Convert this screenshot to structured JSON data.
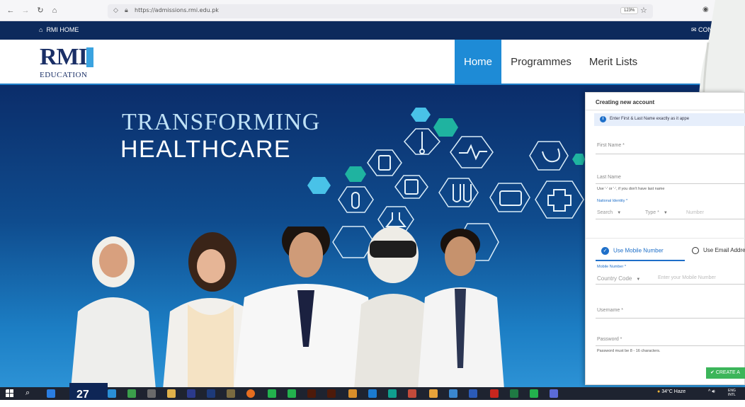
{
  "browser": {
    "url": "https://admissions.rmi.edu.pk",
    "zoom": "123%"
  },
  "topbar": {
    "home_label": "RMI HOME",
    "contact_label": "CONT"
  },
  "logo": {
    "brand": "RMI",
    "subtitle": "EDUCATION"
  },
  "nav": {
    "items": [
      "Home",
      "Programmes",
      "Merit Lists"
    ],
    "active": "Home"
  },
  "hero": {
    "title_line1": "TRANSFORMING",
    "title_line2": "HEALTHCARE"
  },
  "form": {
    "title": "Creating new account",
    "info": "Enter First & Last Name exactly as it appe",
    "first_name_label": "First Name *",
    "last_name_label": "Last Name",
    "last_name_hint": "Use '-' or '-', if you don't have last name",
    "national_identity_label": "National Identity *",
    "search_placeholder": "Search",
    "type_placeholder": "Type *",
    "number_placeholder": "Number",
    "tab_mobile": "Use Mobile Number",
    "tab_email": "Use Email Addre",
    "mobile_label": "Mobile Number *",
    "country_code_placeholder": "Country Code",
    "mobile_placeholder": "Enter your Mobile Number",
    "username_label": "Username *",
    "password_label": "Password *",
    "password_hint": "Password must be 8 - 16 characters.",
    "create_button": "CREATE A"
  },
  "taskbar": {
    "overlay_number": "27",
    "weather": "34°C  Haze",
    "lang_line1": "ENG",
    "lang_line2": "INTL"
  },
  "colors": {
    "header_navy": "#0d2a5c",
    "nav_active": "#1e8bd6",
    "hex_cyan": "#49c2e8",
    "hex_teal": "#1fb3a0",
    "button_green": "#3cb55a"
  }
}
